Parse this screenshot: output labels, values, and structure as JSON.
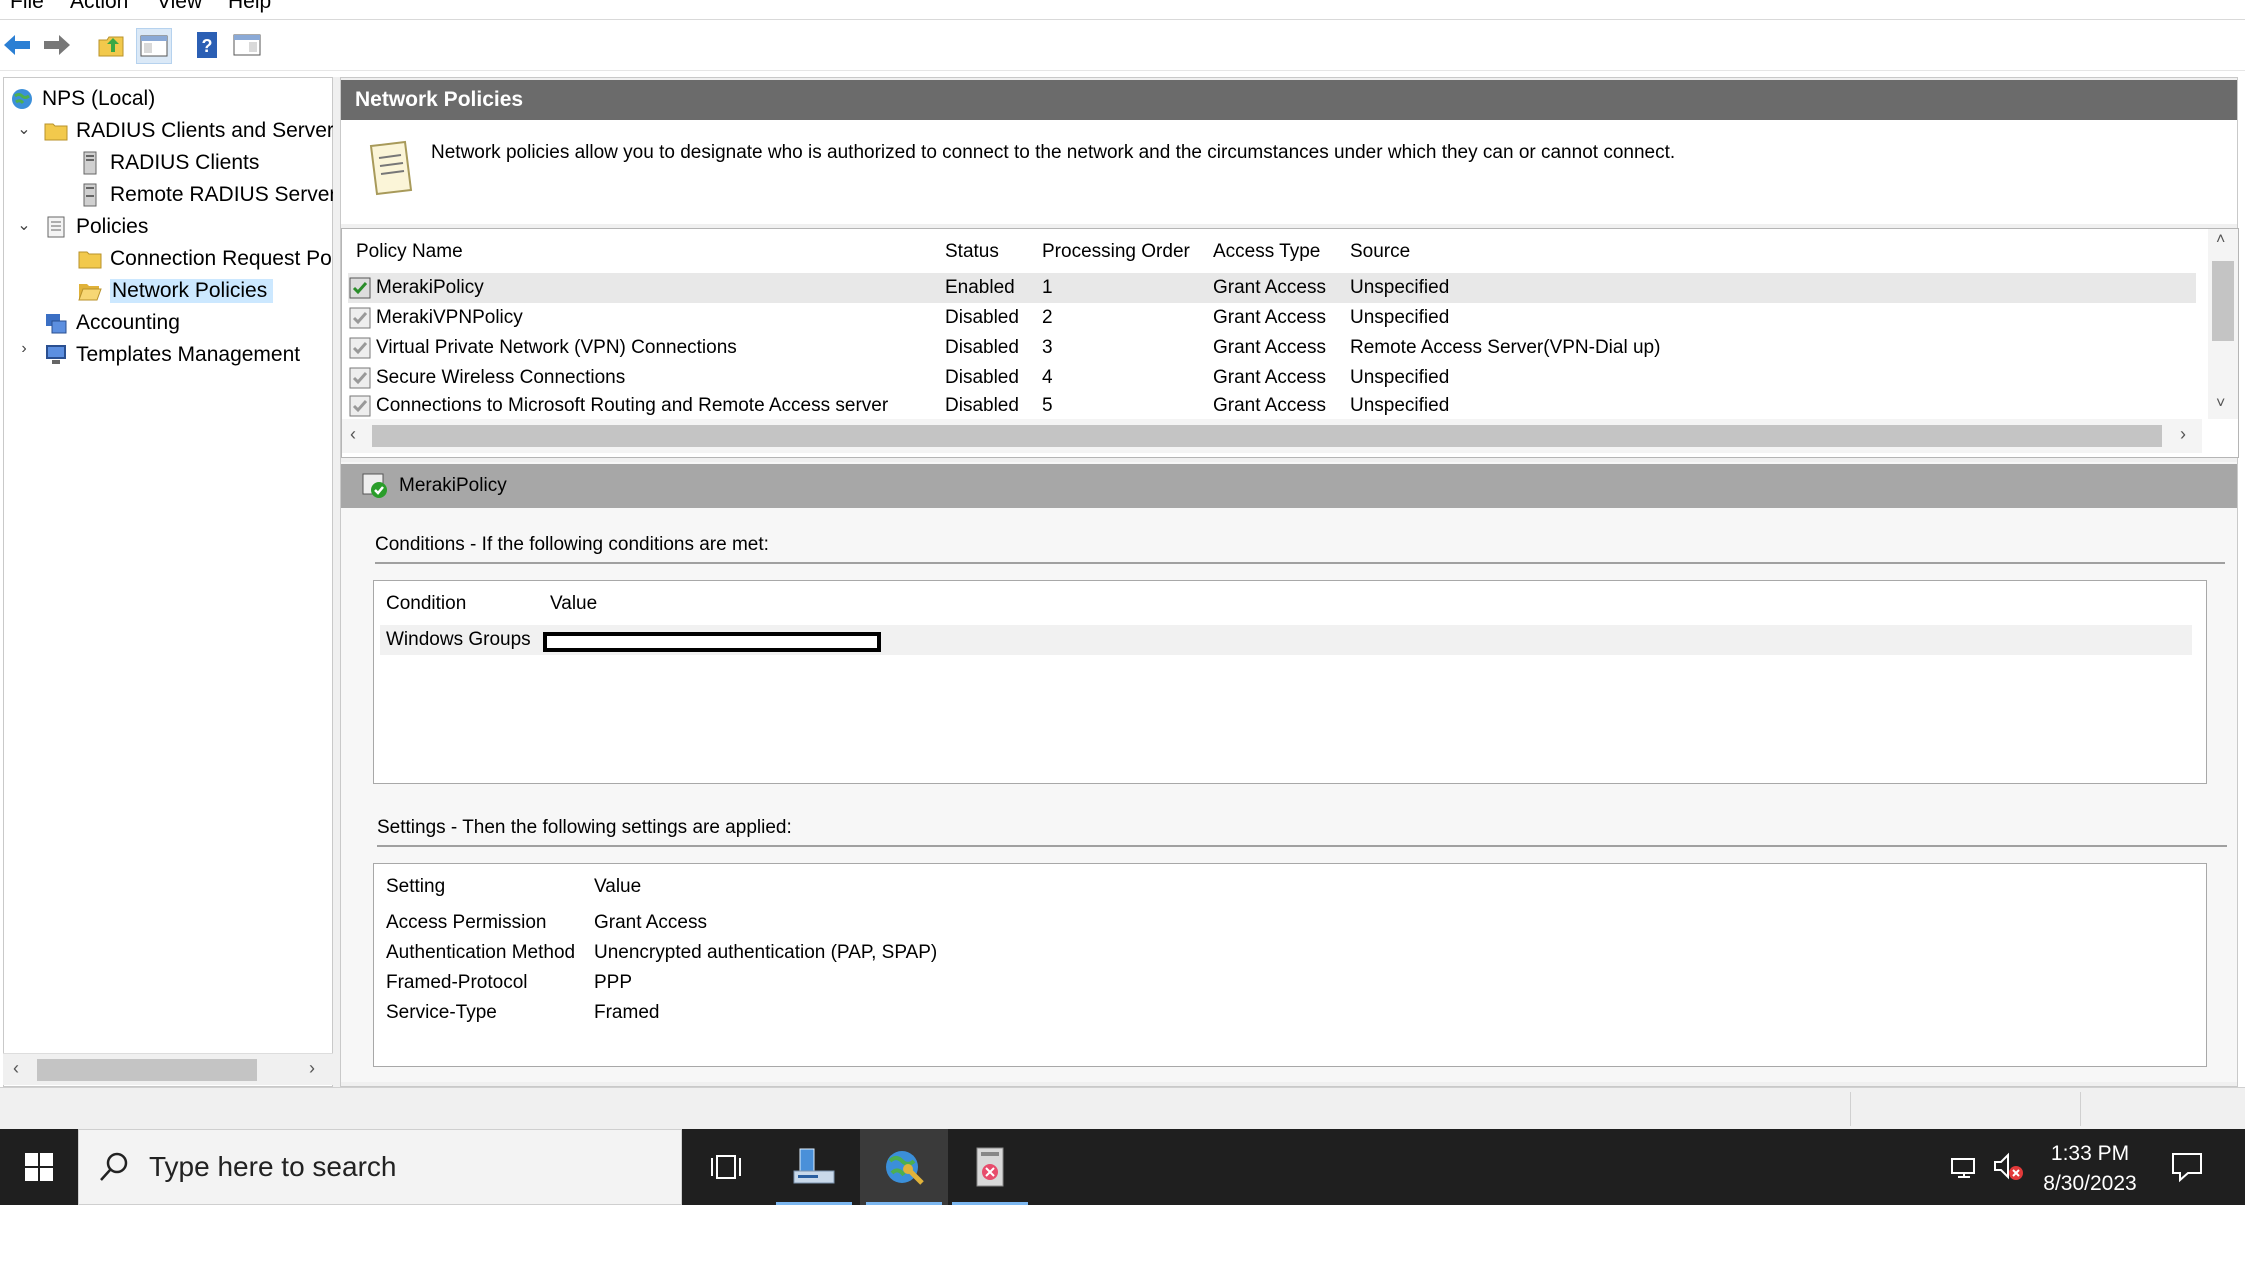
{
  "menu": {
    "items": [
      "File",
      "Action",
      "View",
      "Help"
    ]
  },
  "tree": {
    "root": "NPS (Local)",
    "radius_group": "RADIUS Clients and Servers",
    "radius_clients": "RADIUS Clients",
    "remote_radius": "Remote RADIUS Server (",
    "policies": "Policies",
    "connection_request": "Connection Request Pol",
    "network_policies": "Network Policies",
    "accounting": "Accounting",
    "templates": "Templates Management"
  },
  "main": {
    "title": "Network Policies",
    "description": "Network policies allow you to designate who is authorized to connect to the network and the circumstances under which they can or cannot connect.",
    "columns": [
      "Policy Name",
      "Status",
      "Processing Order",
      "Access Type",
      "Source"
    ],
    "rows": [
      {
        "name": "MerakiPolicy",
        "status": "Enabled",
        "order": "1",
        "access": "Grant Access",
        "source": "Unspecified"
      },
      {
        "name": "MerakiVPNPolicy",
        "status": "Disabled",
        "order": "2",
        "access": "Grant Access",
        "source": "Unspecified"
      },
      {
        "name": "Virtual Private Network (VPN) Connections",
        "status": "Disabled",
        "order": "3",
        "access": "Grant Access",
        "source": "Remote Access Server(VPN-Dial up)"
      },
      {
        "name": "Secure Wireless Connections",
        "status": "Disabled",
        "order": "4",
        "access": "Grant Access",
        "source": "Unspecified"
      },
      {
        "name": "Connections to Microsoft Routing and Remote Access server",
        "status": "Disabled",
        "order": "5",
        "access": "Grant Access",
        "source": "Unspecified"
      }
    ]
  },
  "detail": {
    "title": "MerakiPolicy",
    "conditions_title": "Conditions - If the following conditions are met:",
    "condition_header": "Condition",
    "value_header": "Value",
    "condition_row": {
      "condition": "Windows Groups",
      "value": ""
    },
    "settings_title": "Settings - Then the following settings are applied:",
    "setting_header": "Setting",
    "setting_value_header": "Value",
    "settings": [
      {
        "setting": "Access Permission",
        "value": "Grant Access"
      },
      {
        "setting": "Authentication Method",
        "value": "Unencrypted authentication (PAP, SPAP)"
      },
      {
        "setting": "Framed-Protocol",
        "value": "PPP"
      },
      {
        "setting": "Service-Type",
        "value": "Framed"
      }
    ]
  },
  "taskbar": {
    "search_placeholder": "Type here to search",
    "time": "1:33 PM",
    "date": "8/30/2023"
  }
}
